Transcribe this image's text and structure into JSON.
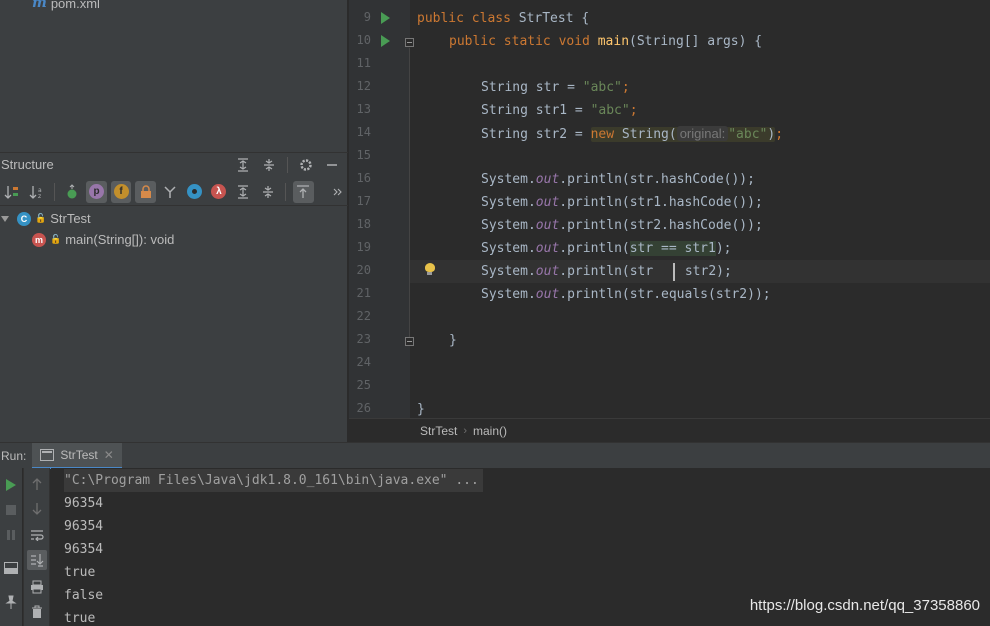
{
  "project": {
    "file": "pom.xml",
    "file_icon": "m"
  },
  "structure": {
    "title": "Structure",
    "toolbar_letters": {
      "p": "p",
      "f": "f",
      "lambda": "λ"
    },
    "tree": [
      {
        "label": "StrTest",
        "icon": "C"
      },
      {
        "label": "main(String[]): void",
        "icon": "m"
      }
    ]
  },
  "editor": {
    "line_numbers": [
      "9",
      "10",
      "11",
      "12",
      "13",
      "14",
      "15",
      "16",
      "17",
      "18",
      "19",
      "20",
      "21",
      "22",
      "23",
      "24",
      "25",
      "26"
    ],
    "code": {
      "l9_kw": "public class ",
      "l9_name": "StrTest",
      "l9_rest": " {",
      "l10_kw1": "public static void ",
      "l10_fn": "main",
      "l10_rest": "(String[] args) {",
      "l12_a": "String str = ",
      "l12_s": "\"abc\"",
      "l12_e": ";",
      "l13_a": "String str1 = ",
      "l13_s": "\"abc\"",
      "l13_e": ";",
      "l14_a": "String str2 = ",
      "l14_new": "new",
      "l14_b": " String(",
      "l14_hint": "original:",
      "l14_s": "\"abc\"",
      "l14_c": ")",
      "l14_e": ";",
      "sys": "System.",
      "out": "out",
      "l16_rest": ".println(str.hashCode());",
      "l17_rest": ".println(str1.hashCode());",
      "l18_rest": ".println(str2.hashCode());",
      "l19_a": ".println(",
      "l19_hl": "str == str1",
      "l19_e": ");",
      "l20_a": ".println(str ",
      "l20_b": " str2);",
      "l21_rest": ".println(str.equals(str2));",
      "l23": "}",
      "l26": "}"
    }
  },
  "breadcrumb": {
    "class": "StrTest",
    "method": "main()"
  },
  "run": {
    "label": "Run:",
    "tab": "StrTest",
    "console": {
      "command": "\"C:\\Program Files\\Java\\jdk1.8.0_161\\bin\\java.exe\" ...",
      "lines": [
        "96354",
        "96354",
        "96354",
        "true",
        "false",
        "true"
      ]
    }
  },
  "watermark": "https://blog.csdn.net/qq_37358860"
}
